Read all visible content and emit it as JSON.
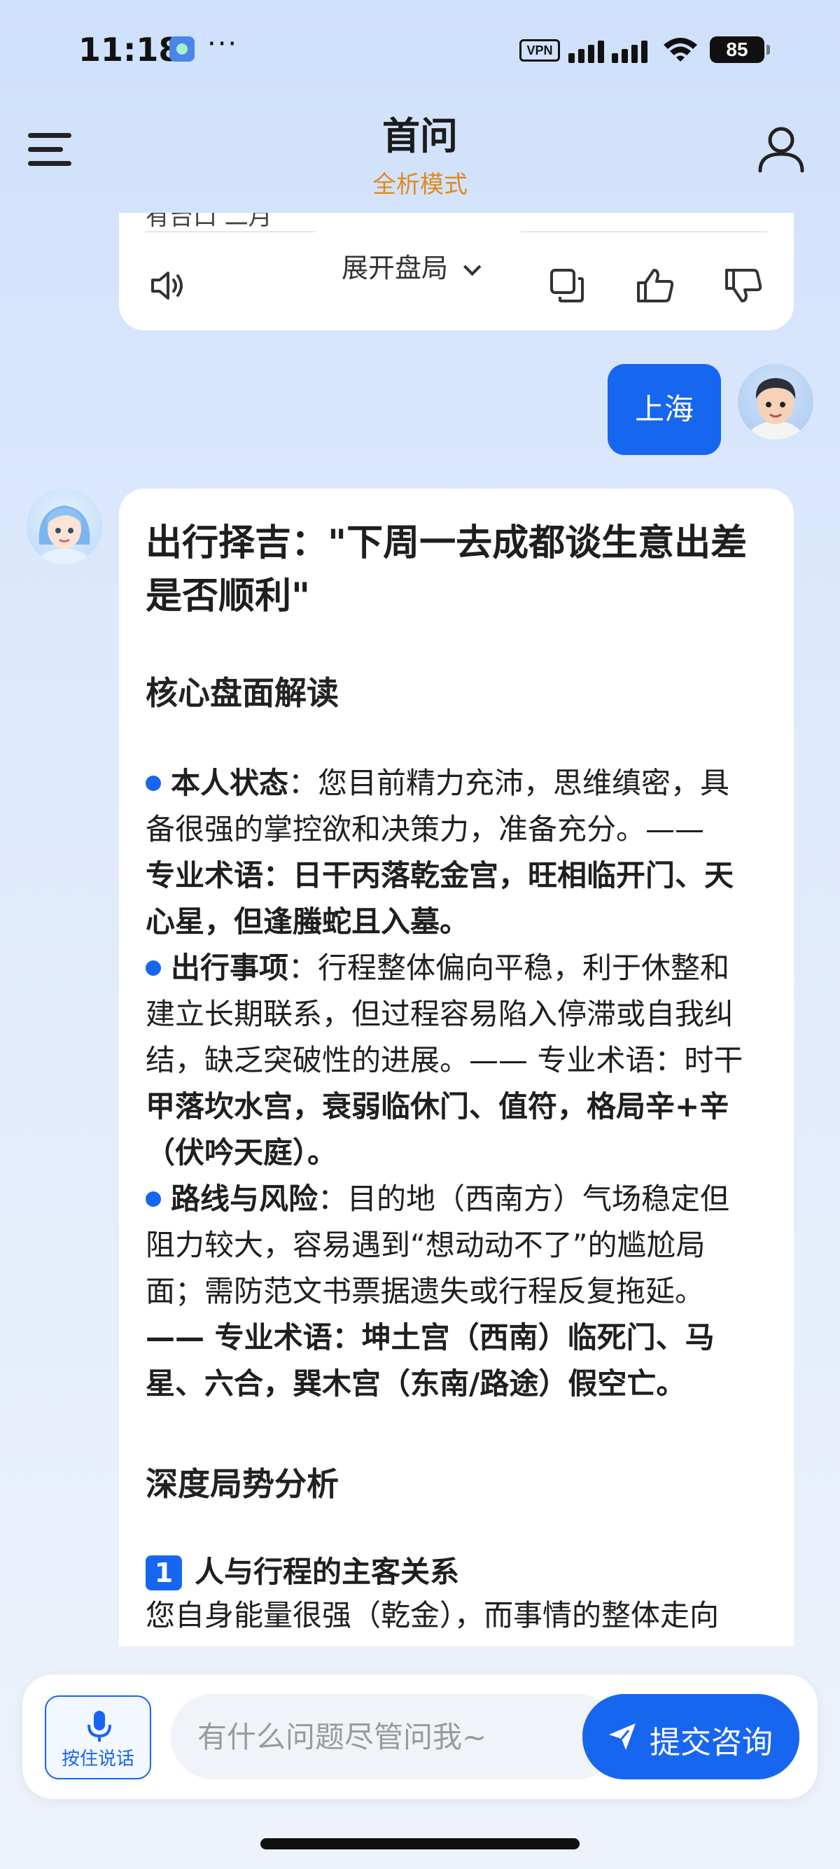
{
  "status_bar": {
    "time": "11:18",
    "more": "···",
    "vpn": "VPN",
    "battery": "85"
  },
  "header": {
    "title": "首问",
    "subtitle": "全析模式"
  },
  "prev_card": {
    "cut_text": "有台口 二月",
    "expand_label": "展开盘局"
  },
  "user_message": "上海",
  "answer": {
    "title_line1": "出行择吉：\"下周一去成都谈生意出差",
    "title_line2": "是否顺利\"",
    "h_core": "核心盘面解读",
    "bullets": [
      {
        "label": "本人状态",
        "lines": [
          "：您目前精力充沛，思维缜密，具",
          "备很强的掌控欲和决策力，准备充分。——",
          "专业术语：日干丙落乾金宫，旺相临开门、天",
          "心星，但逢螣蛇且入墓。"
        ]
      },
      {
        "label": "出行事项",
        "lines": [
          "：行程整体偏向平稳，利于休整和",
          "建立长期联系，但过程容易陷入停滞或自我纠",
          "结，缺乏突破性的进展。—— 专业术语：时干",
          "甲落坎水宫，衰弱临休门、值符，格局辛+辛",
          "（伏吟天庭）。"
        ]
      },
      {
        "label": "路线与风险",
        "lines": [
          "：目的地（西南方）气场稳定但",
          "阻力较大，容易遇到“想动动不了”的尴尬局",
          "面；需防范文书票据遗失或行程反复拖延。",
          "—— 专业术语：坤土宫（西南）临死门、马",
          "星、六合，巽木宫（东南/路途）假空亡。"
        ]
      }
    ],
    "h_deep": "深度局势分析",
    "section1": {
      "num": "1",
      "title": "人与行程的主客关系",
      "body": "您自身能量很强（乾金），而事情的整体走向"
    }
  },
  "input": {
    "voice_label": "按住说话",
    "placeholder": "有什么问题尽管问我~",
    "submit_label": "提交咨询"
  },
  "colors": {
    "accent": "#1766f0",
    "subtitle": "#e08a1e"
  }
}
